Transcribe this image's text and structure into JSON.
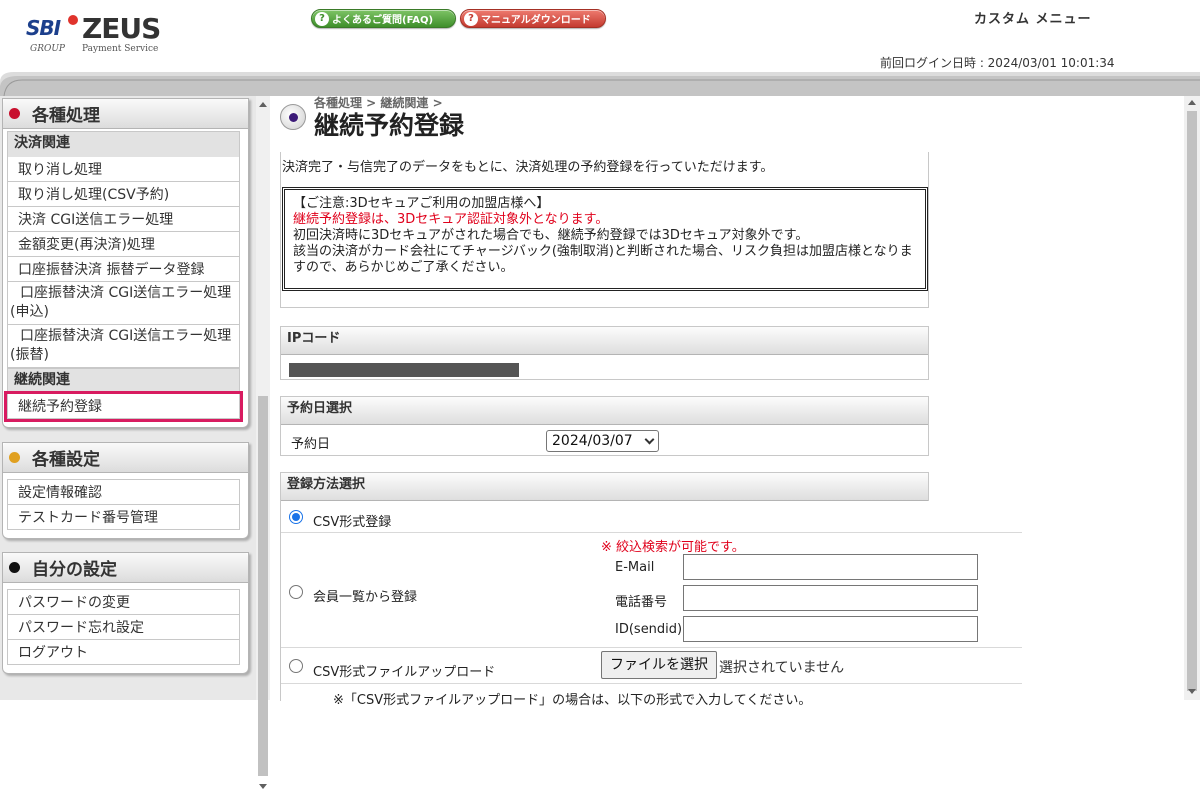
{
  "header": {
    "brand_sbi": "SBI",
    "brand_zeus": "ZEUS",
    "brand_group": "GROUP",
    "brand_payment": "Payment Service",
    "faq_label": "よくあるご質問(FAQ)",
    "manual_label": "マニュアルダウンロード",
    "custom_menu": "カスタム メニュー",
    "last_login": "前回ログイン日時 : 2024/03/01 10:01:34"
  },
  "sidebar": {
    "processing": {
      "title": "各種処理",
      "cat_payment": "決済関連",
      "items": [
        "取り消し処理",
        "取り消し処理(CSV予約)",
        "決済 CGI送信エラー処理",
        "金額変更(再決済)処理",
        "口座振替決済 振替データ登録",
        "口座振替決済 CGI送信エラー処理(申込)",
        "口座振替決済 CGI送信エラー処理(振替)"
      ],
      "cat_recurring": "継続関連",
      "recurring_items": [
        "継続予約登録"
      ]
    },
    "settings": {
      "title": "各種設定",
      "items": [
        "設定情報確認",
        "テストカード番号管理"
      ]
    },
    "my_settings": {
      "title": "自分の設定",
      "items": [
        "パスワードの変更",
        "パスワード忘れ設定",
        "ログアウト"
      ]
    }
  },
  "main": {
    "breadcrumb": "各種処理 > 継続関連 >",
    "title": "継続予約登録",
    "description": "決済完了・与信完了のデータをもとに、決済処理の予約登録を行っていただけます。",
    "notice": {
      "line1": "【ご注意:3Dセキュアご利用の加盟店様へ】",
      "line2": "継続予約登録は、3Dセキュア認証対象外となります。",
      "line3": "初回決済時に3Dセキュアがされた場合でも、継続予約登録では3Dセキュア対象外です。",
      "line4": "該当の決済がカード会社にてチャージバック(強制取消)と判断された場合、リスク負担は加盟店様となりますので、あらかじめご了承ください。"
    },
    "ip_section": {
      "title": "IPコード"
    },
    "date_section": {
      "title": "予約日選択",
      "label": "予約日",
      "selected": "2024/03/07"
    },
    "method_section": {
      "title": "登録方法選択",
      "option_csv": "CSV形式登録",
      "option_member": "会員一覧から登録",
      "filter_note": "※ 絞込検索が可能です。",
      "email_label": "E-Mail",
      "phone_label": "電話番号",
      "sendid_label": "ID(sendid)",
      "option_upload": "CSV形式ファイルアップロード",
      "file_button": "ファイルを選択",
      "file_status": "選択されていません",
      "upload_note": "※「CSV形式ファイルアップロード」の場合は、以下の形式で入力してください。"
    }
  },
  "colors": {
    "accent_red": "#e0001b",
    "active_outline": "#d81b60",
    "dot_processing": "#c8102e",
    "dot_settings": "#e0a020",
    "dot_my": "#111111",
    "radio_blue": "#1a73e8"
  }
}
